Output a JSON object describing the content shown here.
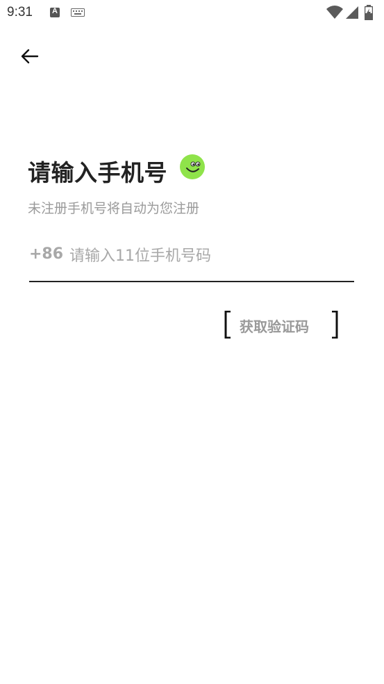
{
  "status_bar": {
    "time": "9:31",
    "a_icon_letter": "A",
    "icons": [
      "wifi-icon",
      "signal-icon",
      "battery-charging-icon"
    ]
  },
  "header": {
    "back_icon": "arrow-left-icon"
  },
  "login": {
    "title": "请输入手机号",
    "title_icon": "smile-face-icon",
    "subtitle": "未注册手机号将自动为您注册",
    "country_code": "+86",
    "phone_placeholder": "请输入11位手机号码",
    "phone_value": "",
    "get_code_label": "获取验证码"
  },
  "colors": {
    "accent_green": "#8fe34a",
    "hint_gray": "#a8a8a8",
    "text_dark": "#222222"
  }
}
